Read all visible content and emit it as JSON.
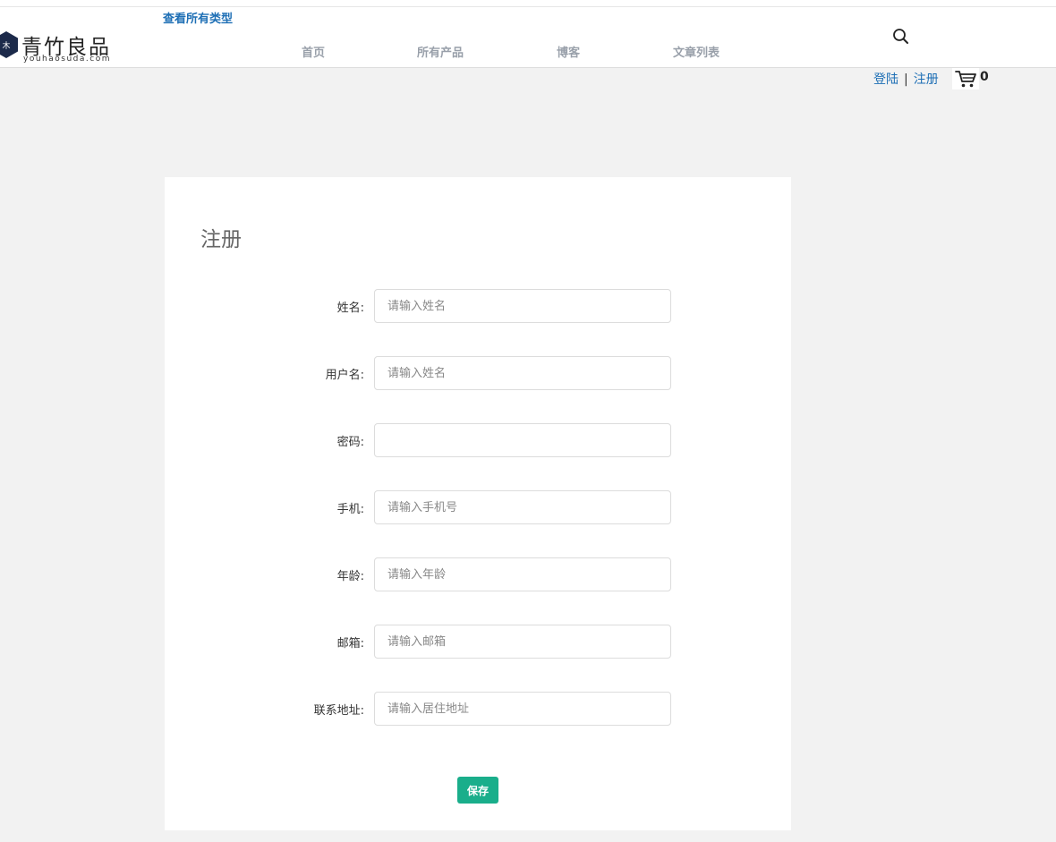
{
  "header": {
    "all_types_link": "查看所有类型",
    "logo": {
      "brand": "青竹良品",
      "domain": "youhaosuda.com",
      "seal_icon": "logo-seal-icon"
    },
    "nav": [
      {
        "label": "首页"
      },
      {
        "label": "所有产品"
      },
      {
        "label": "博客"
      },
      {
        "label": "文章列表"
      }
    ],
    "search_icon": "search-icon"
  },
  "account": {
    "login": "登陆",
    "separator": "|",
    "register": "注册",
    "cart_icon": "cart-icon",
    "cart_count": "0"
  },
  "form": {
    "title": "注册",
    "fields": [
      {
        "label": "姓名:",
        "placeholder": "请输入姓名",
        "value": ""
      },
      {
        "label": "用户名:",
        "placeholder": "请输入姓名",
        "value": ""
      },
      {
        "label": "密码:",
        "placeholder": "",
        "value": ""
      },
      {
        "label": "手机:",
        "placeholder": "请输入手机号",
        "value": ""
      },
      {
        "label": "年龄:",
        "placeholder": "请输入年龄",
        "value": ""
      },
      {
        "label": "邮箱:",
        "placeholder": "请输入邮箱",
        "value": ""
      },
      {
        "label": "联系地址:",
        "placeholder": "请输入居住地址",
        "value": ""
      }
    ],
    "save_label": "保存"
  },
  "colors": {
    "link": "#1e6fb5",
    "nav_text": "#99a0aa",
    "primary_button": "#1aae8b",
    "page_background": "#f2f2f2"
  }
}
